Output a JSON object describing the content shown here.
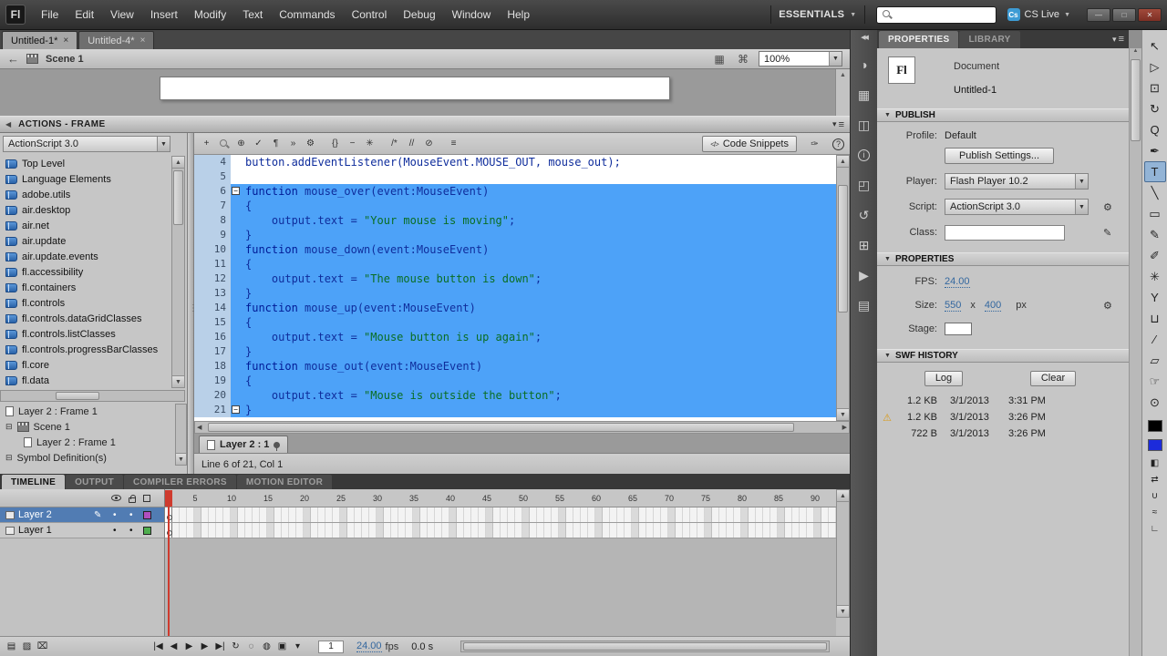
{
  "menubar": {
    "logo": "Fl",
    "menus": [
      "File",
      "Edit",
      "View",
      "Insert",
      "Modify",
      "Text",
      "Commands",
      "Control",
      "Debug",
      "Window",
      "Help"
    ],
    "workspace": "ESSENTIALS",
    "search_value": "",
    "cs_live_label": "CS Live",
    "cs_live_badge": "Cs"
  },
  "document_tabs": [
    {
      "label": "Untitled-1*",
      "active": true
    },
    {
      "label": "Untitled-4*",
      "active": false
    }
  ],
  "edit_bar": {
    "scene_label": "Scene 1",
    "zoom_value": "100%"
  },
  "actions_panel": {
    "title": "ACTIONS - FRAME",
    "language_select": "ActionScript 3.0",
    "library_tree": [
      "Top Level",
      "Language Elements",
      "adobe.utils",
      "air.desktop",
      "air.net",
      "air.update",
      "air.update.events",
      "fl.accessibility",
      "fl.containers",
      "fl.controls",
      "fl.controls.dataGridClasses",
      "fl.controls.listClasses",
      "fl.controls.progressBarClasses",
      "fl.core",
      "fl.data"
    ],
    "script_navigator": {
      "current": "Layer 2 : Frame 1",
      "scene": "Scene 1",
      "scene_child": "Layer 2 : Frame 1",
      "symbols": "Symbol Definition(s)"
    },
    "toolbar": {
      "code_snippets_label": "Code Snippets"
    },
    "code": {
      "lines": [
        {
          "n": 4,
          "t": "button.addEventListener(MouseEvent.MOUSE_OUT, mouse_out);",
          "sel": false,
          "fold": false
        },
        {
          "n": 5,
          "t": "",
          "sel": false,
          "fold": false
        },
        {
          "n": 6,
          "t": "function mouse_over(event:MouseEvent)",
          "sel": true,
          "fold": true
        },
        {
          "n": 7,
          "t": "{",
          "sel": true,
          "fold": false
        },
        {
          "n": 8,
          "t": "    output.text = \"Your mouse is moving\";",
          "sel": true,
          "fold": false
        },
        {
          "n": 9,
          "t": "}",
          "sel": true,
          "fold": false
        },
        {
          "n": 10,
          "t": "function mouse_down(event:MouseEvent)",
          "sel": true,
          "fold": false
        },
        {
          "n": 11,
          "t": "{",
          "sel": true,
          "fold": false
        },
        {
          "n": 12,
          "t": "    output.text = \"The mouse button is down\";",
          "sel": true,
          "fold": false
        },
        {
          "n": 13,
          "t": "}",
          "sel": true,
          "fold": false
        },
        {
          "n": 14,
          "t": "function mouse_up(event:MouseEvent)",
          "sel": true,
          "fold": false
        },
        {
          "n": 15,
          "t": "{",
          "sel": true,
          "fold": false
        },
        {
          "n": 16,
          "t": "    output.text = \"Mouse button is up again\";",
          "sel": true,
          "fold": false
        },
        {
          "n": 17,
          "t": "}",
          "sel": true,
          "fold": false
        },
        {
          "n": 18,
          "t": "function mouse_out(event:MouseEvent)",
          "sel": true,
          "fold": false
        },
        {
          "n": 19,
          "t": "{",
          "sel": true,
          "fold": false
        },
        {
          "n": 20,
          "t": "    output.text = \"Mouse is outside the button\";",
          "sel": true,
          "fold": false
        },
        {
          "n": 21,
          "t": "}",
          "sel": true,
          "fold": true
        }
      ],
      "script_tab": "Layer 2 : 1",
      "status": "Line 6 of 21, Col 1"
    }
  },
  "bottom_panel": {
    "tabs": [
      "TIMELINE",
      "OUTPUT",
      "COMPILER ERRORS",
      "MOTION EDITOR"
    ],
    "active_tab": "TIMELINE",
    "timeline": {
      "layers": [
        {
          "name": "Layer 2",
          "active": true,
          "outline_color": "#b14ebe"
        },
        {
          "name": "Layer 1",
          "active": false,
          "outline_color": "#4fae4f"
        }
      ],
      "ruler_numbers": [
        5,
        10,
        15,
        20,
        25,
        30,
        35,
        40,
        45,
        50,
        55,
        60,
        65,
        70,
        75,
        80,
        85,
        90
      ],
      "current_frame": "1",
      "frame_rate": "24.00",
      "frame_rate_unit": "fps",
      "elapsed_time": "0.0 s"
    }
  },
  "properties_panel": {
    "tabs": [
      "PROPERTIES",
      "LIBRARY"
    ],
    "active_tab": "PROPERTIES",
    "doc_icon": "Fl",
    "doc_type": "Document",
    "doc_name": "Untitled-1",
    "publish": {
      "title": "PUBLISH",
      "profile_label": "Profile:",
      "profile_value": "Default",
      "publish_settings_button": "Publish Settings...",
      "player_label": "Player:",
      "player_value": "Flash Player 10.2",
      "script_label": "Script:",
      "script_value": "ActionScript 3.0",
      "class_label": "Class:",
      "class_value": ""
    },
    "properties": {
      "title": "PROPERTIES",
      "fps_label": "FPS:",
      "fps_value": "24.00",
      "size_label": "Size:",
      "size_width": "550",
      "size_sep": "x",
      "size_height": "400",
      "size_units": "px",
      "stage_label": "Stage:",
      "stage_color": "#ffffff"
    },
    "swf_history": {
      "title": "SWF HISTORY",
      "log_button": "Log",
      "clear_button": "Clear",
      "entries": [
        {
          "size": "1.2 KB",
          "date": "3/1/2013",
          "time": "3:31 PM",
          "warning": false
        },
        {
          "size": "1.2 KB",
          "date": "3/1/2013",
          "time": "3:26 PM",
          "warning": true
        },
        {
          "size": "722 B",
          "date": "3/1/2013",
          "time": "3:26 PM",
          "warning": false
        }
      ]
    }
  },
  "icons": {
    "code_toolbar": [
      "add",
      "find",
      "insert-target-path",
      "check-syntax",
      "auto-format",
      "show-code-hint",
      "debug-options",
      "collapse-between-braces",
      "collapse-selection",
      "expand-all",
      "apply-block-comment",
      "apply-line-comment",
      "remove-comment",
      "show-toolbox"
    ],
    "dock": [
      "color",
      "swatches",
      "align",
      "info",
      "transform",
      "history",
      "components",
      "motion-presets",
      "project"
    ],
    "tools": [
      "selection",
      "subselection",
      "free-transform",
      "3d-rotation",
      "lasso",
      "pen",
      "text",
      "line",
      "rectangle",
      "pencil",
      "brush",
      "deco",
      "bone",
      "paint-bucket",
      "eyedropper",
      "eraser",
      "hand",
      "zoom"
    ],
    "active_tool": "text",
    "stroke_color": "#000000",
    "fill_color": "#1c2bdb"
  }
}
